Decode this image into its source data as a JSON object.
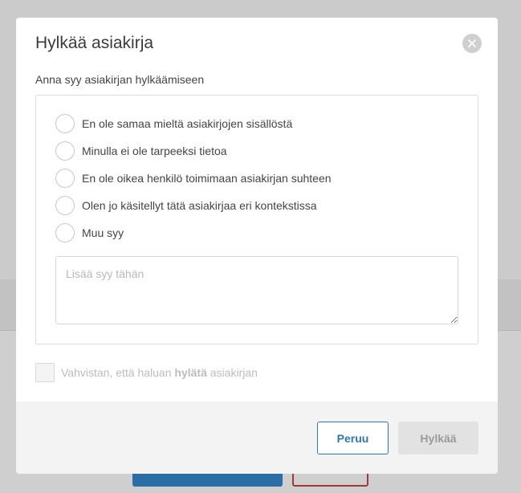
{
  "dialog": {
    "title": "Hylkää asiakirja",
    "prompt": "Anna syy asiakirjan hylkäämiseen",
    "reasons": [
      "En ole samaa mieltä asiakirjojen sisällöstä",
      "Minulla ei ole tarpeeksi tietoa",
      "En ole oikea henkilö toimimaan asiakirjan suhteen",
      "Olen jo käsitellyt tätä asiakirjaa eri kontekstissa",
      "Muu syy"
    ],
    "reason_placeholder": "Lisää syy tähän",
    "confirm": {
      "prefix": "Vahvistan, että haluan ",
      "emphasis": "hylätä",
      "suffix": " asiakirjan",
      "checked": false
    },
    "buttons": {
      "cancel": "Peruu",
      "reject": "Hylkää"
    }
  },
  "icons": {
    "close": "close-icon"
  },
  "colors": {
    "primary": "#2b78b0",
    "disabled_button_bg": "#e2e2e2",
    "disabled_text": "#bdbdbd",
    "overlay": "#c9c9c9"
  }
}
